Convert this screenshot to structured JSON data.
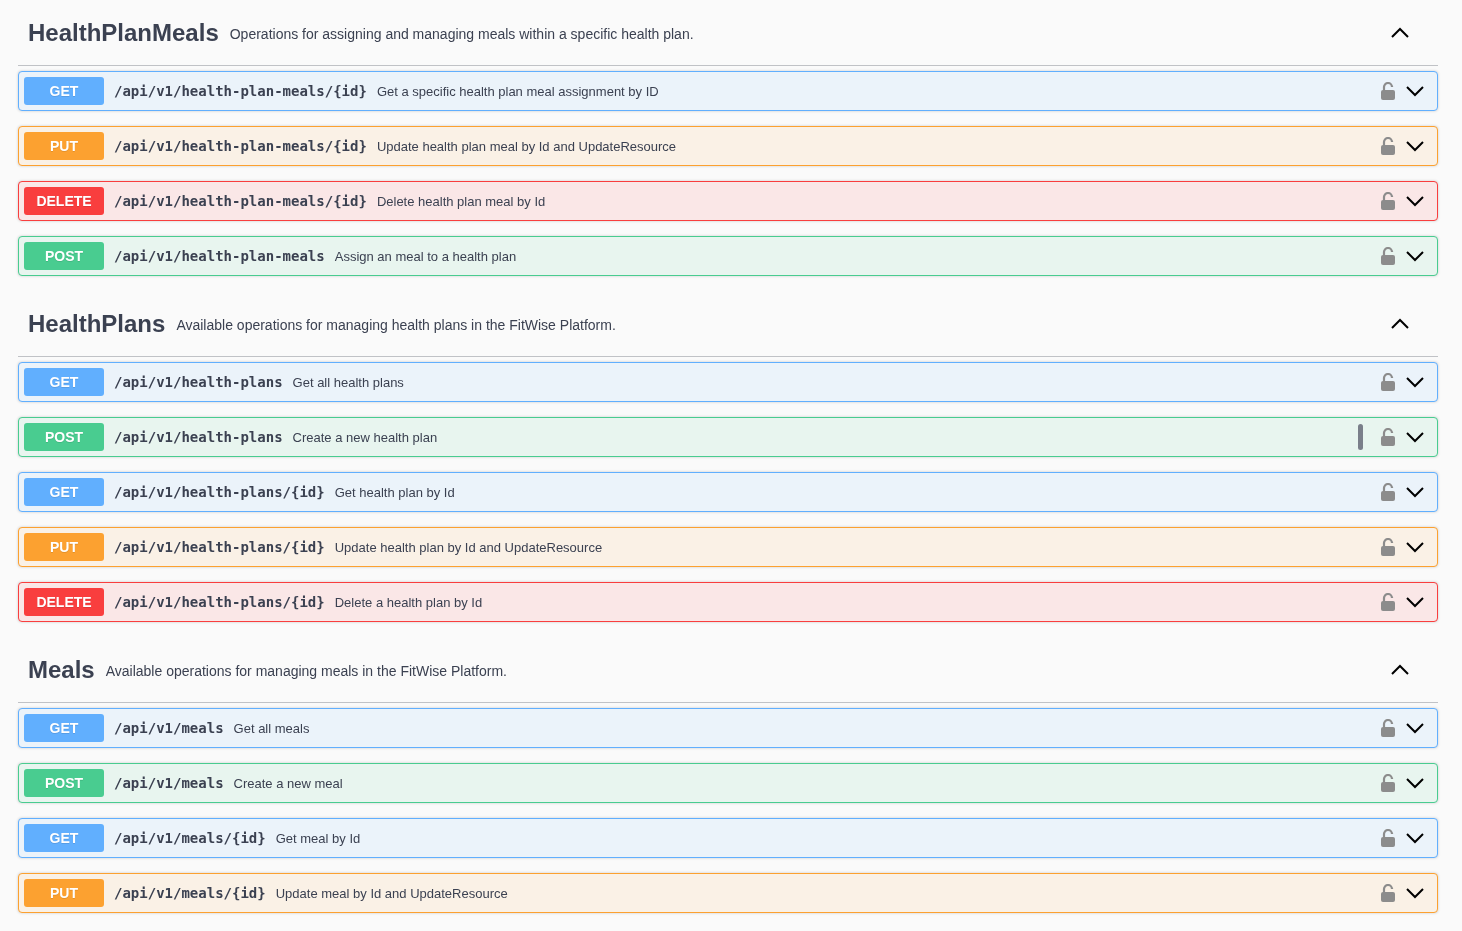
{
  "sections": [
    {
      "name": "HealthPlanMeals",
      "description": "Operations for assigning and managing meals within a specific health plan.",
      "expanded": true,
      "operations": [
        {
          "method": "GET",
          "color": "#61affe",
          "path": "/api/v1/health-plan-meals/{id}",
          "summary": "Get a specific health plan meal assignment by ID",
          "expanded": false
        },
        {
          "method": "PUT",
          "color": "#fca130",
          "path": "/api/v1/health-plan-meals/{id}",
          "summary": "Update health plan meal by Id and UpdateResource",
          "expanded": false
        },
        {
          "method": "DELETE",
          "color": "#f93e3e",
          "path": "/api/v1/health-plan-meals/{id}",
          "summary": "Delete health plan meal by Id",
          "expanded": false
        },
        {
          "method": "POST",
          "color": "#49cc90",
          "path": "/api/v1/health-plan-meals",
          "summary": "Assign an meal to a health plan",
          "expanded": false
        }
      ]
    },
    {
      "name": "HealthPlans",
      "description": "Available operations for managing health plans in the FitWise Platform.",
      "expanded": true,
      "operations": [
        {
          "method": "GET",
          "color": "#61affe",
          "path": "/api/v1/health-plans",
          "summary": "Get all health plans",
          "expanded": false
        },
        {
          "method": "POST",
          "color": "#49cc90",
          "path": "/api/v1/health-plans",
          "summary": "Create a new health plan",
          "expanded": false,
          "handle": true
        },
        {
          "method": "GET",
          "color": "#61affe",
          "path": "/api/v1/health-plans/{id}",
          "summary": "Get health plan by Id",
          "expanded": false
        },
        {
          "method": "PUT",
          "color": "#fca130",
          "path": "/api/v1/health-plans/{id}",
          "summary": "Update health plan by Id and UpdateResource",
          "expanded": false
        },
        {
          "method": "DELETE",
          "color": "#f93e3e",
          "path": "/api/v1/health-plans/{id}",
          "summary": "Delete a health plan by Id",
          "expanded": false
        }
      ]
    },
    {
      "name": "Meals",
      "description": "Available operations for managing meals in the FitWise Platform.",
      "expanded": true,
      "operations": [
        {
          "method": "GET",
          "color": "#61affe",
          "path": "/api/v1/meals",
          "summary": "Get all meals",
          "expanded": false
        },
        {
          "method": "POST",
          "color": "#49cc90",
          "path": "/api/v1/meals",
          "summary": "Create a new meal",
          "expanded": false
        },
        {
          "method": "GET",
          "color": "#61affe",
          "path": "/api/v1/meals/{id}",
          "summary": "Get meal by Id",
          "expanded": false
        },
        {
          "method": "PUT",
          "color": "#fca130",
          "path": "/api/v1/meals/{id}",
          "summary": "Update meal by Id and UpdateResource",
          "expanded": false
        }
      ]
    }
  ]
}
